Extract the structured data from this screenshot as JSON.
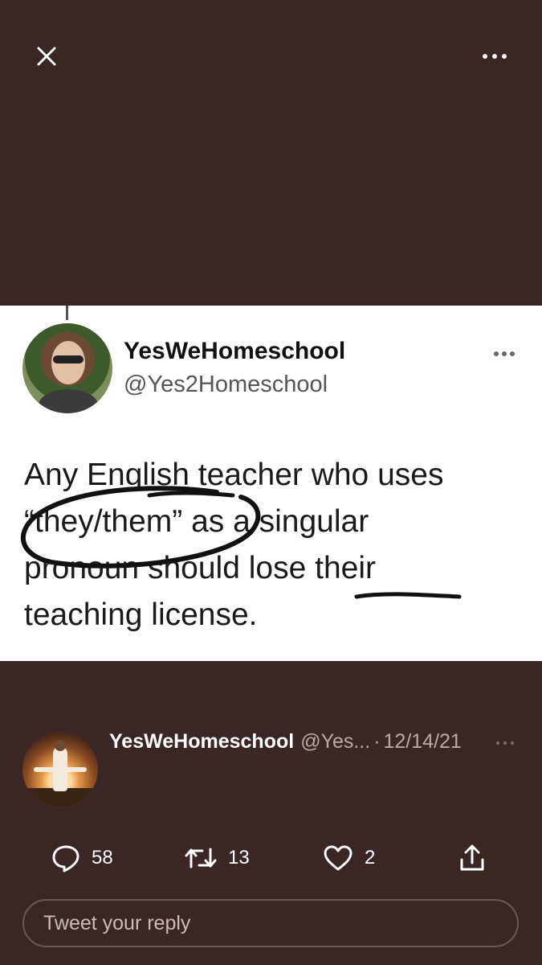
{
  "top_bar": {
    "close_icon": "close-icon",
    "more_icon": "more-horizontal-icon"
  },
  "media": {
    "inner_tweet": {
      "display_name": "YesWeHomeschool",
      "handle": "@Yes2Homeschool",
      "more_icon": "more-horizontal-icon",
      "text_line_1": "Any English teacher who uses",
      "text_line_2": "“they/them” as a singular",
      "text_line_3": "pronoun should lose their",
      "text_line_4": "teaching license."
    },
    "annotation_color": "#111111"
  },
  "tweet": {
    "display_name": "YesWeHomeschool",
    "handle": "@Yes...",
    "separator": "·",
    "date": "12/14/21",
    "more_icon": "more-horizontal-icon"
  },
  "actions": {
    "reply": {
      "icon": "reply-icon",
      "count": "58"
    },
    "retweet": {
      "icon": "retweet-icon",
      "count": "13"
    },
    "like": {
      "icon": "heart-icon",
      "count": "2"
    },
    "share": {
      "icon": "share-icon"
    }
  },
  "reply_input": {
    "placeholder": "Tweet your reply",
    "value": ""
  },
  "colors": {
    "background": "#3a2624",
    "text": "#ffffff",
    "muted": "#b9aaa6"
  }
}
